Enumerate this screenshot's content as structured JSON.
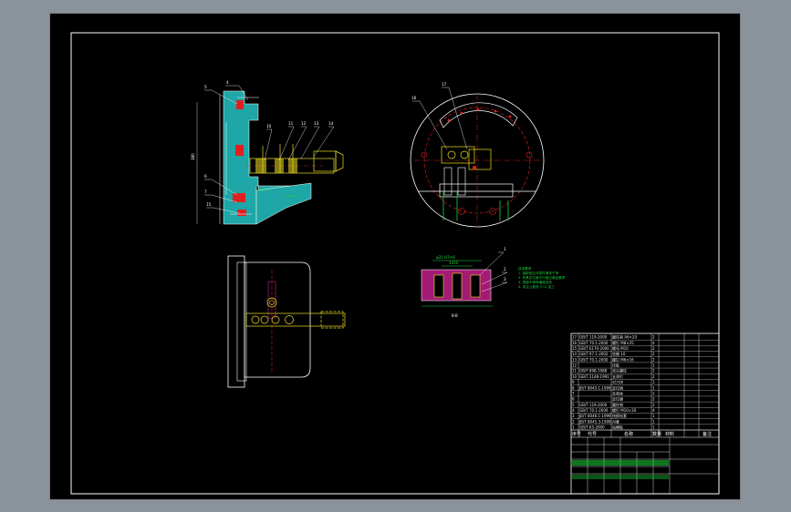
{
  "drawing": {
    "colors": {
      "viewport": "#8a929c",
      "sheet": "#000000",
      "frame": "#ffffff",
      "cyan": "#1fa6a6",
      "red": "#e02020",
      "yellow": "#f0e020",
      "green": "#19d63a",
      "magenta": "#c0208a",
      "white": "#ffffff"
    },
    "views": {
      "front_callouts": [
        "4",
        "5",
        "6",
        "7",
        "10",
        "11",
        "12",
        "13",
        "14",
        "15"
      ],
      "front_height_dim": "380",
      "top_callouts": [
        "16",
        "17"
      ],
      "section_callouts": [
        "1",
        "2",
        "3"
      ],
      "section_label": "B-B",
      "section_dim_top": "φ25 H7/n6",
      "section_dim_inner": "1420"
    },
    "tech_notes": [
      "技术要求",
      "1. 装配前应对零件清洗干净",
      "2. 夹具定位面平行度应满足要求",
      "3. 表面不得有磕碰划伤",
      "4. 未注公差按 IT12 加工"
    ],
    "title_block": {
      "parts_rows": [
        {
          "no": "17",
          "code": "GB/T 119-2000",
          "name": "圆柱销 A6×20",
          "qty": "2"
        },
        {
          "no": "16",
          "code": "GB/T 70.1-2000",
          "name": "螺钉 M8×25",
          "qty": "4"
        },
        {
          "no": "15",
          "code": "GB/T 6170-2000",
          "name": "螺母 M10",
          "qty": "2"
        },
        {
          "no": "14",
          "code": "GB/T 97.1-2002",
          "name": "垫圈 10",
          "qty": "2"
        },
        {
          "no": "13",
          "code": "GB/T 70.1-2000",
          "name": "螺钉 M6×16",
          "qty": "2"
        },
        {
          "no": "12",
          "code": "",
          "name": "压板",
          "qty": "1"
        },
        {
          "no": "11",
          "code": "GB/T 898-1988",
          "name": "双头螺柱",
          "qty": "2"
        },
        {
          "no": "10",
          "code": "GB/T 2148-1991",
          "name": "支承钉",
          "qty": "2"
        },
        {
          "no": "9",
          "code": "",
          "name": "对刀块",
          "qty": "1"
        },
        {
          "no": "8",
          "code": "JB/T 8045.1-1999",
          "name": "定位销",
          "qty": "1"
        },
        {
          "no": "7",
          "code": "",
          "name": "夹具体",
          "qty": "1"
        },
        {
          "no": "6",
          "code": "",
          "name": "定位键",
          "qty": "2"
        },
        {
          "no": "5",
          "code": "GB/T 119-2000",
          "name": "圆柱销",
          "qty": "2"
        },
        {
          "no": "4",
          "code": "GB/T 70.1-2000",
          "name": "螺钉 M10×30",
          "qty": "4"
        },
        {
          "no": "3",
          "code": "JB/T 8046.1-1999",
          "name": "快换钻套",
          "qty": "1"
        },
        {
          "no": "2",
          "code": "JB/T 8045.3-1999",
          "name": "衬套",
          "qty": "1"
        },
        {
          "no": "1",
          "code": "GB/T 65-2000",
          "name": "钻模板",
          "qty": "1"
        }
      ],
      "header": {
        "no": "序号",
        "code": "代号",
        "name": "名称",
        "qty": "数量",
        "material": "材料",
        "note": "备注"
      }
    }
  }
}
